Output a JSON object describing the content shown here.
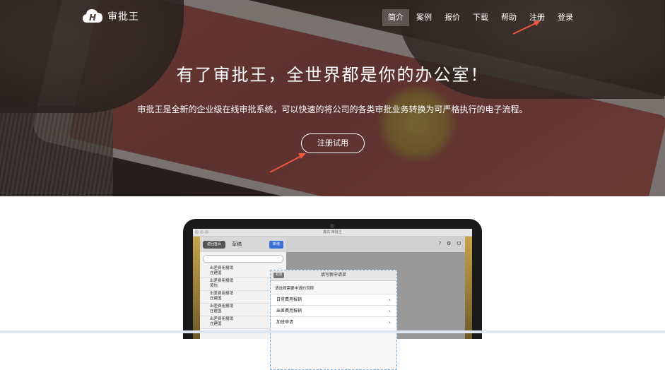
{
  "brand": {
    "name": "审批王"
  },
  "nav": {
    "items": [
      {
        "label": "简介",
        "active": true
      },
      {
        "label": "案例"
      },
      {
        "label": "报价"
      },
      {
        "label": "下载"
      },
      {
        "label": "帮助"
      },
      {
        "label": "注册"
      },
      {
        "label": "登录"
      }
    ]
  },
  "hero": {
    "headline": "有了审批王，全世界都是你的办公室！",
    "subline": "审批王是全新的企业级在线审批系统，可以快速的将公司的各类审批业务转换为可严格执行的电子流程。",
    "cta": "注册试用"
  },
  "annotation_color": "#f0573b",
  "laptop": {
    "window_title": "鑫鸟 审批王",
    "left_pane": {
      "back": "返回首页",
      "title": "草稿",
      "new": "新增",
      "rows": [
        {
          "title": "出差费用报销",
          "sub": "庄建国"
        },
        {
          "title": "出差费用报销",
          "sub": "黄怡"
        },
        {
          "title": "出差费用报销",
          "sub": "庄建国"
        },
        {
          "title": "出差费用报销",
          "sub": "庄建国"
        },
        {
          "title": "出差费用报销",
          "sub": "庄建国"
        }
      ]
    },
    "dialog": {
      "cancel": "取消",
      "title": "填写新申请单",
      "hint": "请选择需要申请的流程",
      "items": [
        "日常费用报销",
        "出差费用报销",
        "加班申请"
      ]
    }
  }
}
